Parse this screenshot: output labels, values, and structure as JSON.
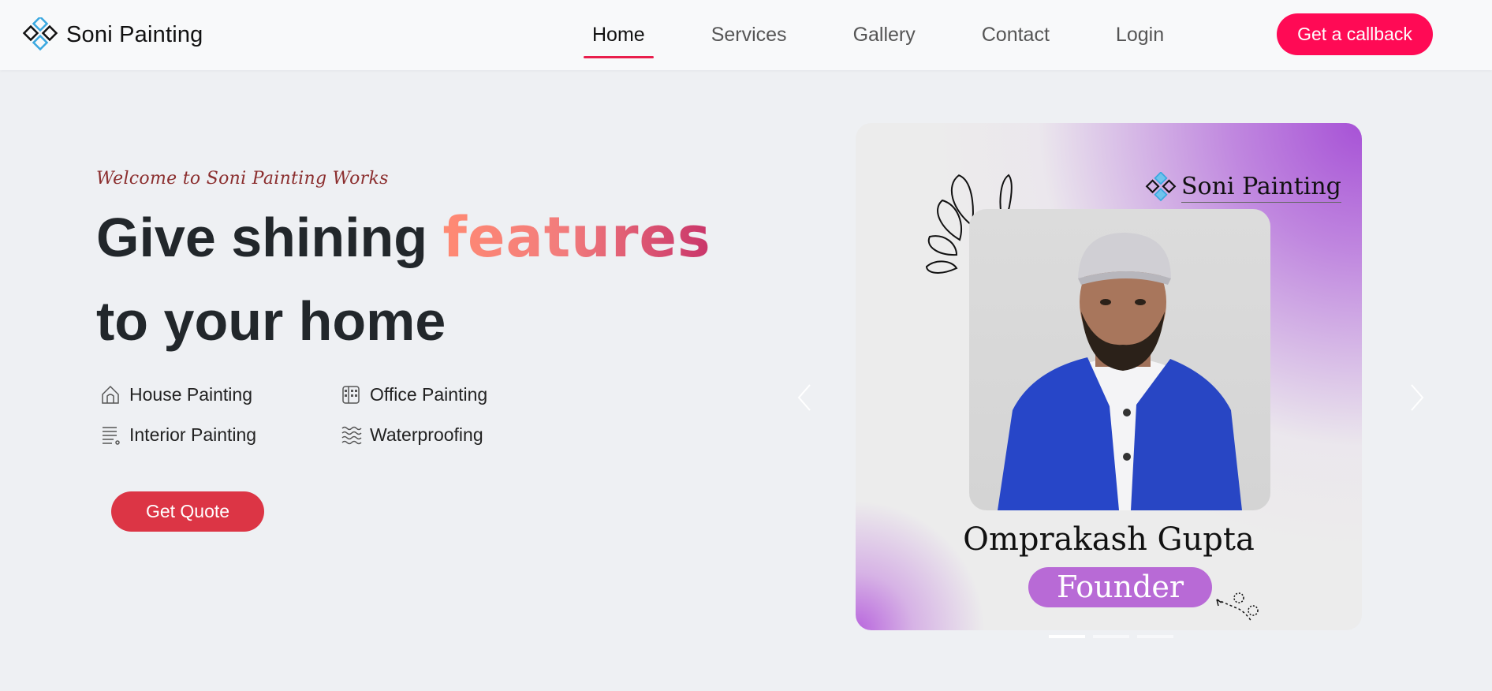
{
  "nav": {
    "brand": "Soni Painting",
    "links": [
      {
        "label": "Home",
        "active": true
      },
      {
        "label": "Services",
        "active": false
      },
      {
        "label": "Gallery",
        "active": false
      },
      {
        "label": "Contact",
        "active": false
      },
      {
        "label": "Login",
        "active": false
      }
    ],
    "cta_label": "Get a callback"
  },
  "hero": {
    "welcome": "Welcome to Soni Painting Works",
    "headline_part1": "Give shining ",
    "headline_highlight": "features",
    "headline_part2": "to your home",
    "features": [
      {
        "label": "House Painting",
        "icon": "house-icon"
      },
      {
        "label": "Office Painting",
        "icon": "building-icon"
      },
      {
        "label": "Interior Painting",
        "icon": "document-icon"
      },
      {
        "label": "Waterproofing",
        "icon": "water-icon"
      }
    ],
    "quote_label": "Get Quote"
  },
  "carousel": {
    "slide_brand": "Soni Painting",
    "person_name": "Omprakash Gupta",
    "person_role": "Founder",
    "indicator_count": 3,
    "active_index": 0
  },
  "colors": {
    "accent": "#ff0a55",
    "quote_button": "#dc3545",
    "badge": "#b86ad6",
    "highlight_gradient": [
      "#ff8a73",
      "#c9356a"
    ]
  }
}
